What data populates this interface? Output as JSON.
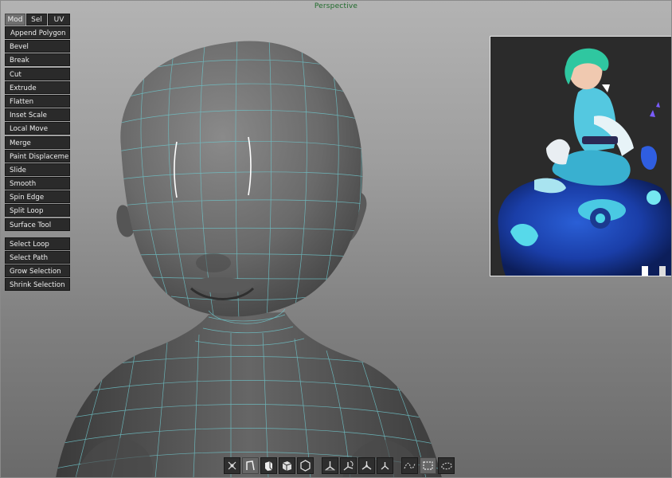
{
  "viewport": {
    "title": "Perspective"
  },
  "mode_tabs": [
    {
      "label": "Mod",
      "active": true
    },
    {
      "label": "Sel",
      "active": false
    },
    {
      "label": "UV",
      "active": false
    }
  ],
  "modeling_tools": [
    "Append Polygon",
    "Bevel",
    "Break",
    "Cut",
    "Extrude",
    "Flatten",
    "Inset Scale",
    "Local Move",
    "Merge",
    "Paint Displacement",
    "Slide",
    "Smooth",
    "Spin Edge",
    "Split Loop",
    "Surface Tool"
  ],
  "selection_tools": [
    "Select Loop",
    "Select Path",
    "Grow Selection",
    "Shrink Selection"
  ],
  "bottom_toolbar": {
    "select_mode_icons": [
      "vertex-mode-icon",
      "edge-mode-icon",
      "face-mode-icon",
      "object-face-mode-icon",
      "object-mode-icon"
    ],
    "transform_icons": [
      "world-axis-icon",
      "local-axis-icon",
      "screen-axis-icon",
      "normal-axis-icon"
    ],
    "curve_icons": [
      "curve-icon",
      "box-select-icon",
      "lasso-select-icon"
    ],
    "active_select_mode": "edge-mode-icon",
    "active_curve": "box-select-icon"
  },
  "colors": {
    "wire": "#6fc3c8",
    "selected_edge": "#ffffff",
    "button_bg": "#2a2a2a",
    "title_text": "#1f6a2b"
  }
}
